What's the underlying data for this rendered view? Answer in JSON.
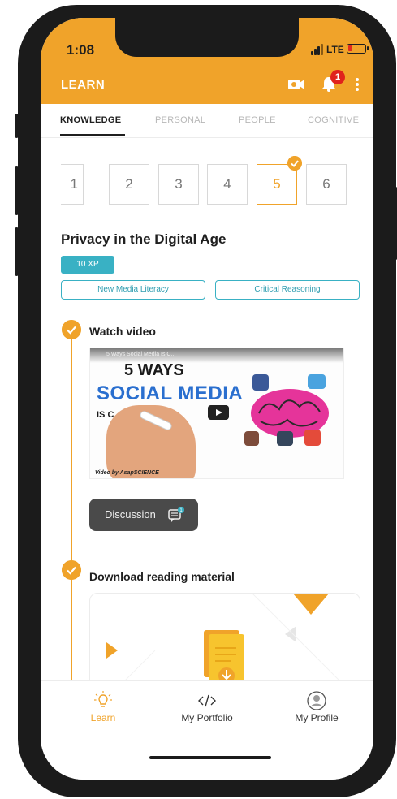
{
  "status_bar": {
    "time": "1:08",
    "network": "LTE"
  },
  "header": {
    "title": "LEARN",
    "notification_count": "1"
  },
  "tabs": [
    {
      "label": "KNOWLEDGE",
      "active": true
    },
    {
      "label": "PERSONAL",
      "active": false
    },
    {
      "label": "PEOPLE",
      "active": false
    },
    {
      "label": "COGNITIVE",
      "active": false
    }
  ],
  "steps": [
    {
      "label": "1",
      "completed": false
    },
    {
      "label": "2",
      "completed": false
    },
    {
      "label": "3",
      "completed": false
    },
    {
      "label": "4",
      "completed": false
    },
    {
      "label": "5",
      "completed": true,
      "active": true
    },
    {
      "label": "6",
      "completed": false
    }
  ],
  "lesson": {
    "title": "Privacy in the Digital Age",
    "xp": "10 XP",
    "tags": [
      "New Media Literacy",
      "Critical Reasoning"
    ]
  },
  "sections": [
    {
      "title": "Watch video",
      "completed": true,
      "video": {
        "title": "5 Ways Social Media Is C...",
        "headline_1": "5 WAYS",
        "headline_2": "SOCIAL MEDIA",
        "headline_3": "IS C",
        "credit": "Video by AsapSCIENCE"
      },
      "discussion_label": "Discussion",
      "discussion_count": "1"
    },
    {
      "title": "Download reading material",
      "completed": true
    }
  ],
  "bottom_nav": [
    {
      "label": "Learn",
      "icon": "lightbulb-icon",
      "active": true
    },
    {
      "label": "My Portfolio",
      "icon": "code-icon",
      "active": false
    },
    {
      "label": "My Profile",
      "icon": "profile-icon",
      "active": false
    }
  ],
  "colors": {
    "primary": "#F0A32A",
    "accent": "#39b1c4",
    "badge": "#e0221c",
    "dark_button": "#4a4a4a"
  }
}
